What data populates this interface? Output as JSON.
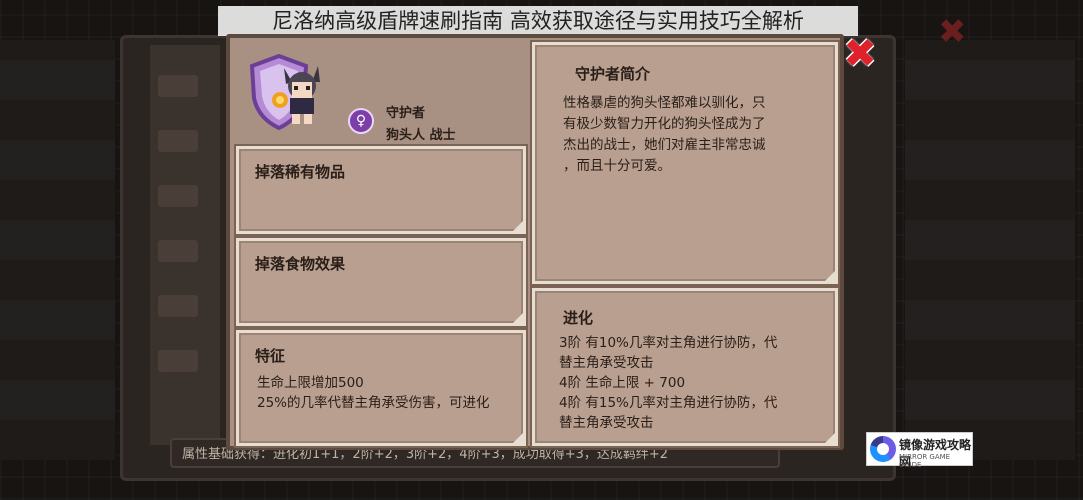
{
  "headline": "尼洛纳高级盾牌速刷指南 高效获取途径与实用技巧全解析",
  "close_glyph": "✖",
  "unit": {
    "role_label": "守护者",
    "type_label": "狗头人 战士"
  },
  "cards": {
    "rare_drop": {
      "title": "掉落稀有物品"
    },
    "food_drop": {
      "title": "掉落食物效果"
    },
    "traits": {
      "title": "特征",
      "lines": [
        "生命上限增加500",
        "25%的几率代替主角承受伤害，可进化"
      ]
    },
    "intro": {
      "title": "守护者简介",
      "lines": [
        "性格暴虐的狗头怪都难以驯化，只",
        "有极少数智力开化的狗头怪成为了",
        "杰出的战士，她们对雇主非常忠诚",
        "，而且十分可爱。"
      ]
    },
    "evolution": {
      "title": "进化",
      "lines": [
        "3阶 有10%几率对主角进行协防，代",
        "替主角承受攻击",
        "4阶 生命上限 + 700",
        "4阶 有15%几率对主角进行协防，代",
        "替主角承受攻击"
      ]
    }
  },
  "background": {
    "bottom_bar": "属性基础获得：进化初1+1，2阶+2，3阶+2，4阶+3，成功取得+3，达成羁绊+2"
  },
  "watermark": {
    "title": "镜像游戏攻略网",
    "subtitle": "MIRROR GAME GUIDE"
  },
  "icons": {
    "shield": "purple-shield-icon",
    "role": "female-symbol-icon",
    "close": "red-x-icon"
  },
  "colors": {
    "card_bg": "#b89f8f",
    "dialog_bg": "#a89082",
    "close_red": "#e0202a",
    "role_purple": "#7c3fa8"
  }
}
